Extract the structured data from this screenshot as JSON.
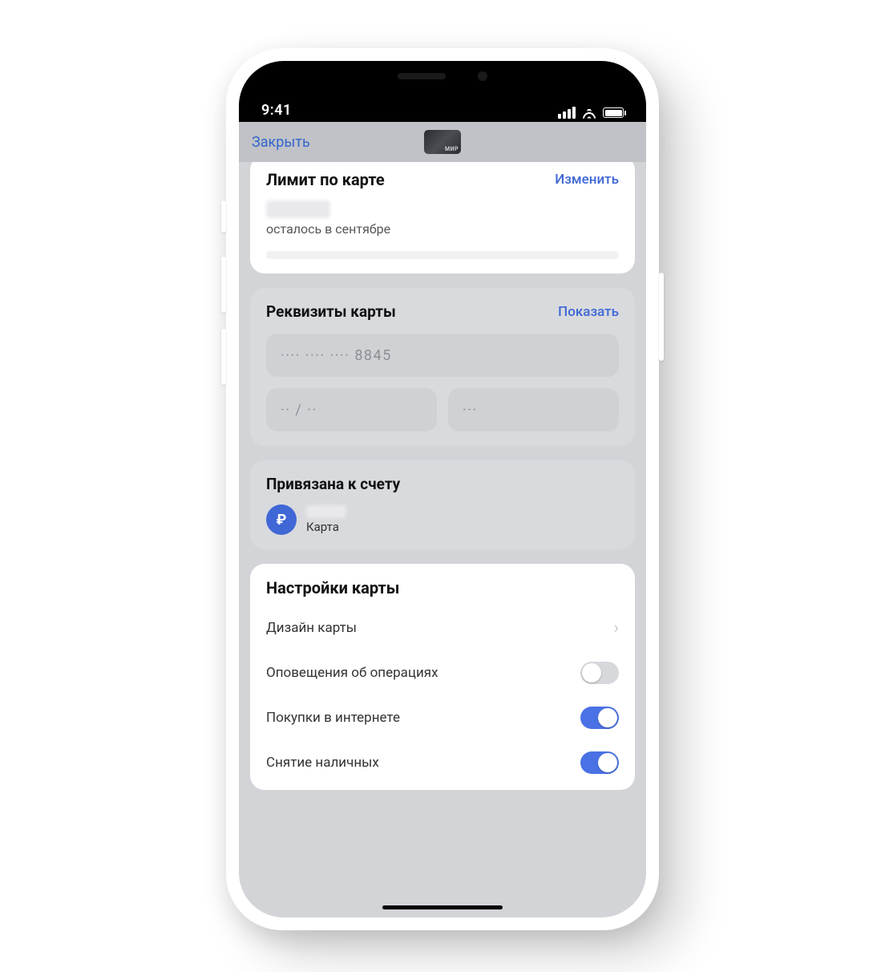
{
  "status": {
    "time": "9:41"
  },
  "nav": {
    "close_label": "Закрыть",
    "card_brand": "МИР"
  },
  "limit": {
    "title": "Лимит по карте",
    "action": "Изменить",
    "remaining_text": "осталось в сентябре"
  },
  "requisites": {
    "title": "Реквизиты карты",
    "action": "Показать",
    "masked_number": "···· ···· ···· 8845",
    "masked_expiry": "·· / ··",
    "masked_cvv": "···"
  },
  "linked": {
    "title": "Привязана к счету",
    "currency_symbol": "₽",
    "sublabel": "Карта"
  },
  "settings": {
    "title": "Настройки карты",
    "items": [
      {
        "label": "Дизайн карты",
        "type": "nav"
      },
      {
        "label": "Оповещения об операциях",
        "type": "toggle",
        "on": false
      },
      {
        "label": "Покупки в интернете",
        "type": "toggle",
        "on": true
      },
      {
        "label": "Снятие наличных",
        "type": "toggle",
        "on": true
      }
    ]
  }
}
